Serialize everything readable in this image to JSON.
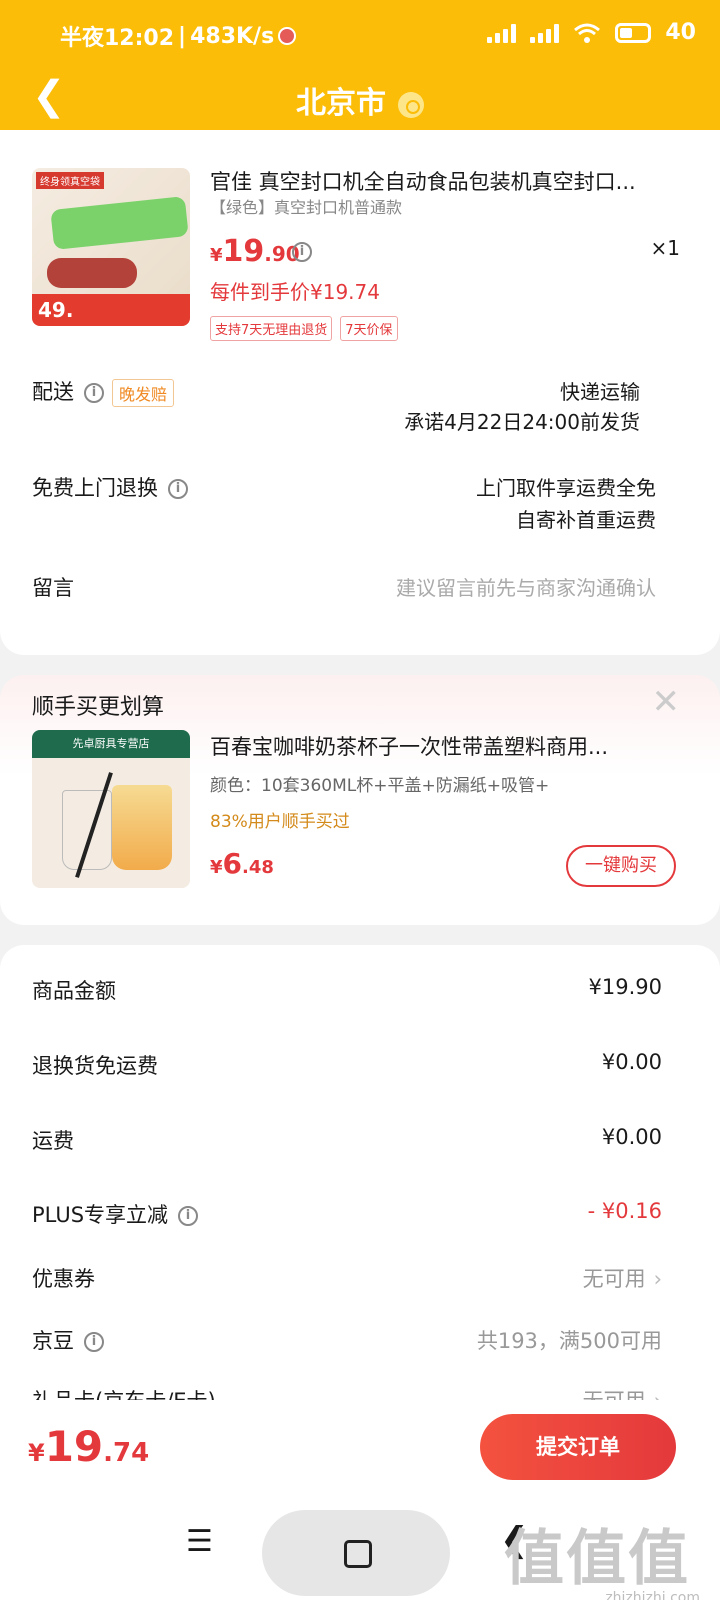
{
  "status_bar": {
    "time_text": "半夜12:02",
    "speed": "483K/s",
    "battery": "40"
  },
  "header": {
    "title": "北京市"
  },
  "product": {
    "title": "官佳 真空封口机全自动食品包装机真空封口...",
    "sku": "【绿色】真空封口机普通款",
    "price_int": "19",
    "price_dec": ".90",
    "qty": "×1",
    "final_price": "每件到手价¥19.74",
    "tags": [
      "支持7天无理由退货",
      "7天价保"
    ],
    "image": {
      "top_tag": "终身领真空袋",
      "price_tag": "49."
    }
  },
  "delivery": {
    "label": "配送",
    "badge": "晚发赔",
    "method": "快递运输",
    "promise": "承诺4月22日24:00前发货"
  },
  "return_service": {
    "label": "免费上门退换",
    "line1": "上门取件享运费全免",
    "line2": "自寄补首重运费"
  },
  "message": {
    "label": "留言",
    "placeholder": "建议留言前先与商家沟通确认"
  },
  "addon": {
    "section_title": "顺手买更划算",
    "name": "百春宝咖啡奶茶杯子一次性带盖塑料商用...",
    "spec": "颜色：10套360ML杯+平盖+防漏纸+吸管+",
    "bought": "83%用户顺手买过",
    "price_int": "6",
    "price_dec": ".48",
    "buy_label": "一键购买",
    "image": {
      "banner": "先卓厨具专营店"
    }
  },
  "summary": {
    "items": [
      {
        "label": "商品金额",
        "value": "¥19.90"
      },
      {
        "label": "退换货免运费",
        "value": "¥0.00"
      },
      {
        "label": "运费",
        "value": "¥0.00"
      },
      {
        "label": "PLUS专享立减",
        "value": "- ¥0.16"
      },
      {
        "label": "优惠券",
        "value": "无可用"
      },
      {
        "label": "京豆",
        "value": "共193，满500可用"
      },
      {
        "label": "礼品卡(京东卡/E卡)",
        "value": "无可用"
      }
    ]
  },
  "footer": {
    "total_int": "19",
    "total_dec": ".74",
    "submit_label": "提交订单"
  },
  "watermark": {
    "big": "值值值",
    "small": "zhizhizhi.com"
  },
  "colors": {
    "header_bg": "#fbbd08",
    "accent_red": "#e4393c",
    "orange": "#f08a24"
  }
}
